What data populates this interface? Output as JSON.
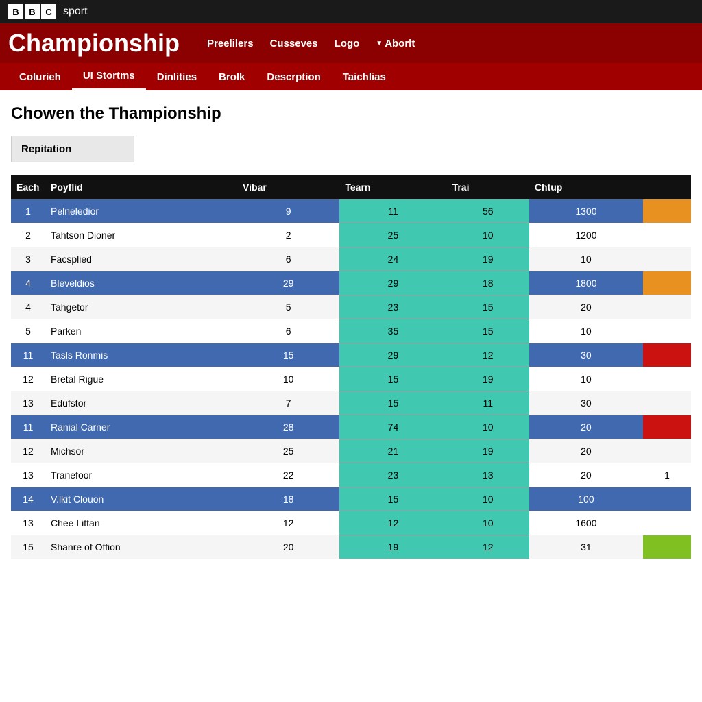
{
  "topbar": {
    "bbc_letters": [
      "B",
      "B",
      "C"
    ],
    "sport_label": "sport"
  },
  "titlebar": {
    "championship": "Championship",
    "nav_items": [
      "Preelilers",
      "Cusseves",
      "Logo"
    ],
    "abort_label": "Aborlt"
  },
  "subnav": {
    "items": [
      "Colurieh",
      "UI Stortms",
      "Dinlities",
      "Brolk",
      "Descrption",
      "Taichlias"
    ],
    "active_index": 1
  },
  "content": {
    "page_heading": "Chowen the Thampionship",
    "filter_label": "Repitation",
    "table": {
      "headers": [
        "Each",
        "Poyflid",
        "Vibar",
        "Tearn",
        "Trai",
        "Chtup",
        ""
      ],
      "rows": [
        {
          "pos": "1",
          "name": "Pelneledior",
          "vibar": "9",
          "team": "11",
          "trai": "56",
          "chtup": "1300",
          "extra": "orange",
          "blue": true
        },
        {
          "pos": "2",
          "name": "Tahtson Dioner",
          "vibar": "2",
          "team": "25",
          "trai": "10",
          "chtup": "1200",
          "extra": "",
          "blue": false
        },
        {
          "pos": "3",
          "name": "Facsplied",
          "vibar": "6",
          "team": "24",
          "trai": "19",
          "chtup": "10",
          "extra": "",
          "blue": false
        },
        {
          "pos": "4",
          "name": "Bleveldios",
          "vibar": "29",
          "team": "29",
          "trai": "18",
          "chtup": "1800",
          "extra": "orange",
          "blue": true
        },
        {
          "pos": "4",
          "name": "Tahgetor",
          "vibar": "5",
          "team": "23",
          "trai": "15",
          "chtup": "20",
          "extra": "",
          "blue": false
        },
        {
          "pos": "5",
          "name": "Parken",
          "vibar": "6",
          "team": "35",
          "trai": "15",
          "chtup": "10",
          "extra": "",
          "blue": false
        },
        {
          "pos": "11",
          "name": "Tasls Ronmis",
          "vibar": "15",
          "team": "29",
          "trai": "12",
          "chtup": "30",
          "extra": "red",
          "blue": true
        },
        {
          "pos": "12",
          "name": "Bretal Rigue",
          "vibar": "10",
          "team": "15",
          "trai": "19",
          "chtup": "10",
          "extra": "",
          "blue": false
        },
        {
          "pos": "13",
          "name": "Edufstor",
          "vibar": "7",
          "team": "15",
          "trai": "11",
          "chtup": "30",
          "extra": "",
          "blue": false
        },
        {
          "pos": "11",
          "name": "Ranial Carner",
          "vibar": "28",
          "team": "74",
          "trai": "10",
          "chtup": "20",
          "extra": "red",
          "blue": true
        },
        {
          "pos": "12",
          "name": "Michsor",
          "vibar": "25",
          "team": "21",
          "trai": "19",
          "chtup": "20",
          "extra": "",
          "blue": false
        },
        {
          "pos": "13",
          "name": "Tranefoor",
          "vibar": "22",
          "team": "23",
          "trai": "13",
          "chtup": "20",
          "extra": "1",
          "blue": false
        },
        {
          "pos": "14",
          "name": "V.lkit Clouon",
          "vibar": "18",
          "team": "15",
          "trai": "10",
          "chtup": "100",
          "extra": "",
          "blue": true
        },
        {
          "pos": "13",
          "name": "Chee Littan",
          "vibar": "12",
          "team": "12",
          "trai": "10",
          "chtup": "1600",
          "extra": "",
          "blue": false
        },
        {
          "pos": "15",
          "name": "Shanre of Offion",
          "vibar": "20",
          "team": "19",
          "trai": "12",
          "chtup": "31",
          "extra": "green",
          "blue": false
        }
      ]
    }
  }
}
